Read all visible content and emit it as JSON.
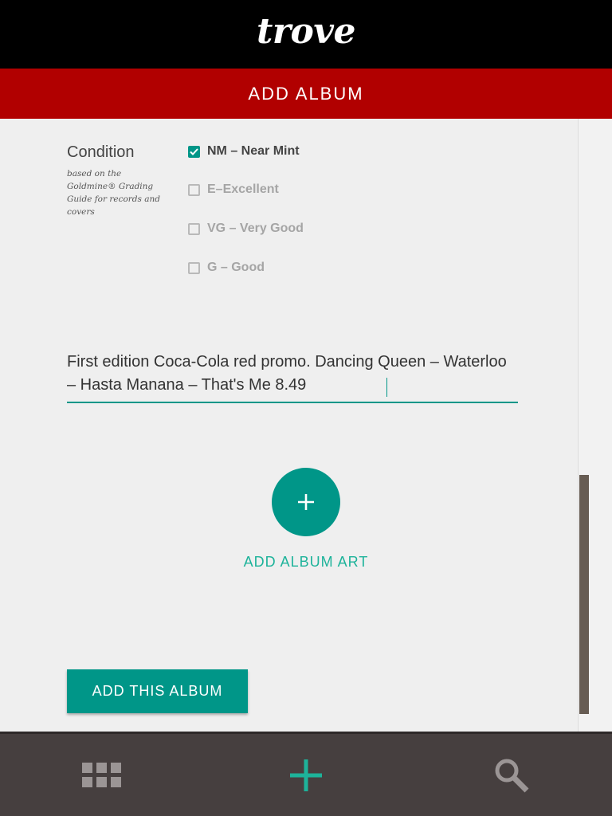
{
  "app": {
    "logo": "trove"
  },
  "header": {
    "title": "ADD ALBUM"
  },
  "condition": {
    "label": "Condition",
    "note": "based on the Goldmine® Grading Guide for records and covers",
    "options": [
      {
        "label": "NM – Near Mint",
        "checked": true
      },
      {
        "label": "E–Excellent",
        "checked": false
      },
      {
        "label": "VG – Very Good",
        "checked": false
      },
      {
        "label": "G – Good",
        "checked": false
      }
    ]
  },
  "notes_field": {
    "value": "First edition Coca-Cola red promo. Dancing Queen – Waterloo – Hasta Manana – That's Me  8.49"
  },
  "album_art": {
    "button_icon": "plus-icon",
    "label": "ADD ALBUM ART"
  },
  "submit": {
    "label": "ADD THIS ALBUM"
  },
  "bottom_nav": {
    "items": [
      {
        "icon": "grid-icon"
      },
      {
        "icon": "plus-icon"
      },
      {
        "icon": "search-icon"
      }
    ]
  },
  "colors": {
    "accent": "#009688",
    "accent_text": "#1db39a",
    "brand_red": "#b10000",
    "nav_bg": "#463f3f"
  }
}
